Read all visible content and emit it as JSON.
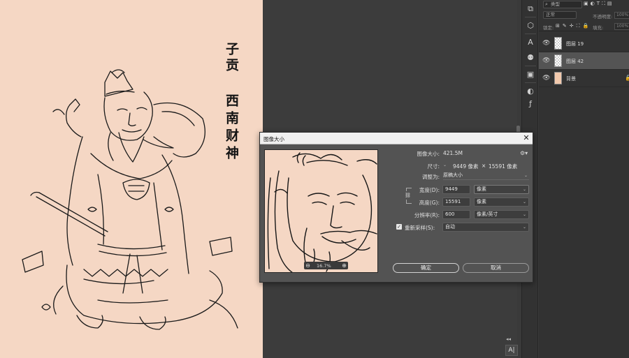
{
  "canvas": {
    "calligraphy_line1": "子贡",
    "calligraphy_line2": "西南财神",
    "artboard_color": "#f5d7c4"
  },
  "toolbar": {
    "tools": [
      "properties-icon",
      "3d-icon",
      "character-icon",
      "adjust-icon",
      "image-icon",
      "styles-icon",
      "fx-icon"
    ]
  },
  "layers_panel": {
    "kind_filter": "类型",
    "blend_mode": "正常",
    "opacity_label": "不透明度:",
    "opacity_value": "100%",
    "lock_label": "锁定:",
    "fill_label": "填充:",
    "fill_value": "100%",
    "layers": [
      {
        "name": "图层 19",
        "visible": true,
        "selected": false,
        "thumb": "transparent",
        "locked": false
      },
      {
        "name": "图层 42",
        "visible": true,
        "selected": true,
        "thumb": "transparent",
        "locked": false
      },
      {
        "name": "背景",
        "visible": true,
        "selected": false,
        "thumb": "background",
        "locked": true
      }
    ]
  },
  "dialog": {
    "title": "图像大小",
    "close": "✕",
    "image_size_label": "图像大小:",
    "image_size_value": "421.5M",
    "dimensions_label": "尺寸:",
    "dimensions_w": "9449 像素",
    "dimensions_x": "×",
    "dimensions_h": "15591 像素",
    "fit_to_label": "调整为:",
    "fit_to_value": "原稿大小",
    "width_label": "宽度(D):",
    "width_value": "9449",
    "width_unit": "像素",
    "height_label": "高度(G):",
    "height_value": "15591",
    "height_unit": "像素",
    "resolution_label": "分辨率(R):",
    "resolution_value": "600",
    "resolution_unit": "像素/英寸",
    "resample_label": "重新采样(S):",
    "resample_checked": true,
    "resample_value": "自动",
    "preview_zoom": "16.7%",
    "ok_label": "确定",
    "cancel_label": "取消"
  },
  "panel_buttons": {
    "character_panel": "A|",
    "collapse": "◂◂"
  }
}
